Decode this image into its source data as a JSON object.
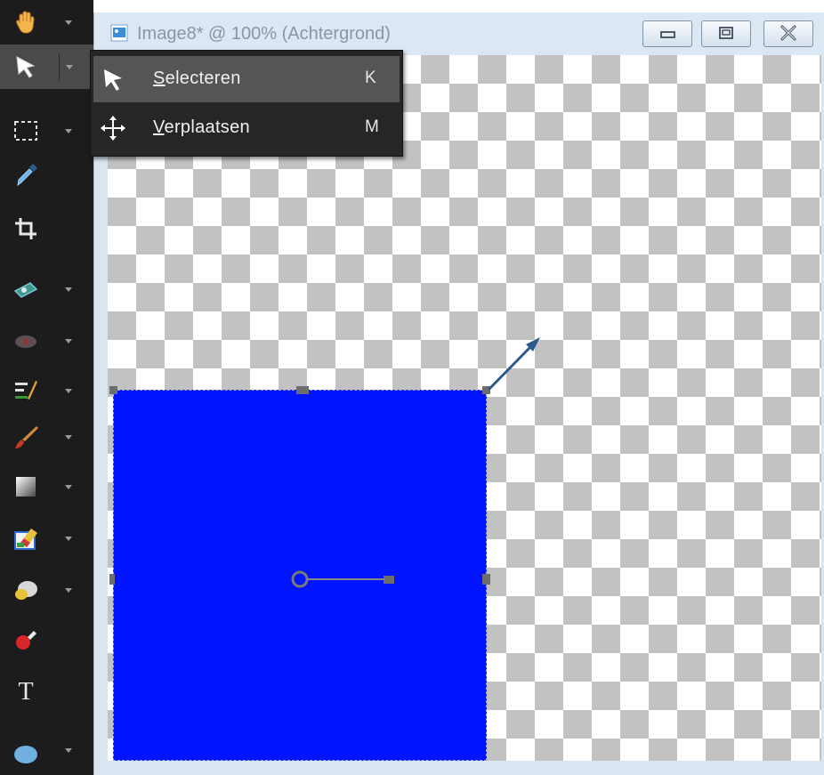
{
  "document": {
    "title": "Image8* @ 100% (Achtergrond)"
  },
  "tools": [
    {
      "name": "pan-tool",
      "icon": "hand-icon",
      "has_dropdown": true
    },
    {
      "name": "pick-tool",
      "icon": "arrow-cursor-icon",
      "has_dropdown": true,
      "active": true
    },
    {
      "name": "selection-tool",
      "icon": "marquee-icon",
      "has_dropdown": true
    },
    {
      "name": "dropper-tool",
      "icon": "eyedropper-icon",
      "has_dropdown": false
    },
    {
      "name": "crop-tool",
      "icon": "crop-icon",
      "has_dropdown": false
    },
    {
      "name": "straighten-tool",
      "icon": "straighten-icon",
      "has_dropdown": true
    },
    {
      "name": "red-eye-tool",
      "icon": "eye-icon",
      "has_dropdown": true
    },
    {
      "name": "clone-tool",
      "icon": "clone-brush-icon",
      "has_dropdown": true
    },
    {
      "name": "paint-brush-tool",
      "icon": "paint-brush-icon",
      "has_dropdown": true
    },
    {
      "name": "gradient-tool",
      "icon": "gradient-icon",
      "has_dropdown": true
    },
    {
      "name": "eraser-tool",
      "icon": "eraser-icon",
      "has_dropdown": true
    },
    {
      "name": "flood-fill-tool",
      "icon": "paint-bucket-icon",
      "has_dropdown": true
    },
    {
      "name": "picture-tube-tool",
      "icon": "picture-tube-icon",
      "has_dropdown": false
    },
    {
      "name": "text-tool",
      "icon": "text-icon",
      "has_dropdown": false
    },
    {
      "name": "shape-tool",
      "icon": "ellipse-icon",
      "has_dropdown": true
    }
  ],
  "flyout": {
    "items": [
      {
        "label": "Selecteren",
        "shortcut": "K",
        "icon": "arrow-cursor-icon",
        "highlighted": true
      },
      {
        "label": "Verplaatsen",
        "shortcut": "M",
        "icon": "move-icon",
        "highlighted": false
      }
    ]
  },
  "colors": {
    "layer_fill": "#0014ff",
    "toolbar_bg": "#1c1c1c",
    "menu_bg": "#262626",
    "menu_highlight": "#555555",
    "window_chrome": "#dbe7f3",
    "arrow_annotation": "#2d5a8c"
  }
}
